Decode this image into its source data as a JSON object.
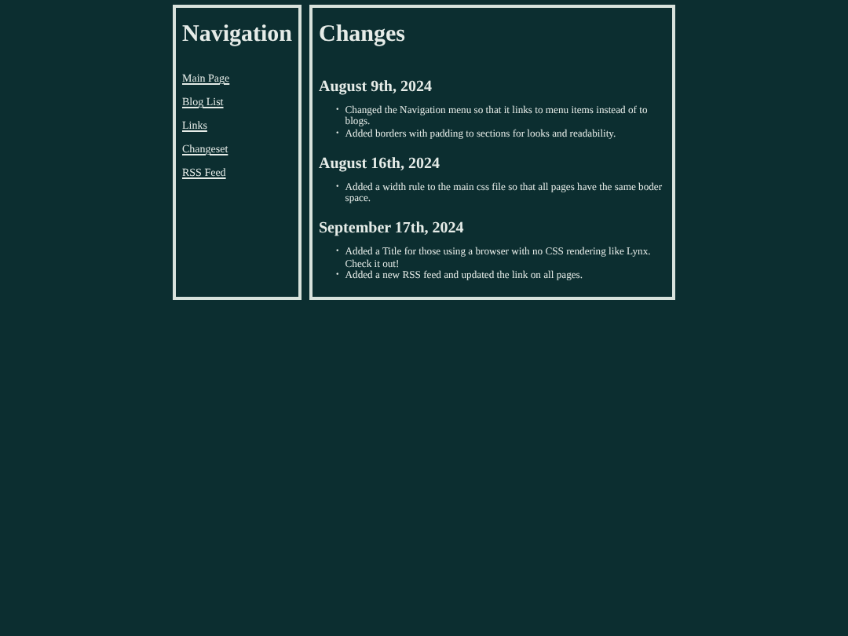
{
  "navigation": {
    "title": "Navigation",
    "links": [
      "Main Page",
      "Blog List",
      "Links",
      "Changeset",
      "RSS Feed"
    ]
  },
  "main": {
    "title": "Changes",
    "bullet": "•",
    "sections": [
      {
        "heading": "August 9th, 2024",
        "items": [
          "Changed the Navigation menu so that it links to menu items instead of to blogs.",
          "Added borders with padding to sections for looks and readability."
        ]
      },
      {
        "heading": "August 16th, 2024",
        "items": [
          "Added a width rule to the main css file so that all pages have the same boder space."
        ]
      },
      {
        "heading": "September 17th, 2024",
        "items": [
          "Added a Title for those using a browser with no CSS rendering like Lynx. Check it out!",
          "Added a new RSS feed and updated the link on all pages."
        ]
      }
    ]
  }
}
